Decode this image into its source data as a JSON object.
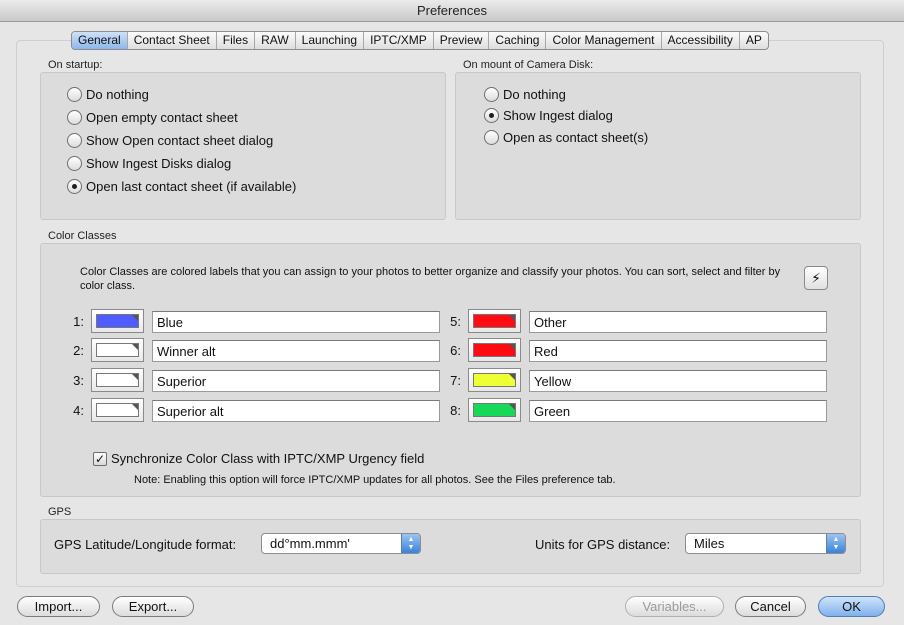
{
  "window": {
    "title": "Preferences"
  },
  "tabs": [
    {
      "label": "General",
      "active": true
    },
    {
      "label": "Contact Sheet"
    },
    {
      "label": "Files"
    },
    {
      "label": "RAW"
    },
    {
      "label": "Launching"
    },
    {
      "label": "IPTC/XMP"
    },
    {
      "label": "Preview"
    },
    {
      "label": "Caching"
    },
    {
      "label": "Color Management"
    },
    {
      "label": "Accessibility"
    },
    {
      "label": "AP"
    }
  ],
  "startup": {
    "label": "On startup:",
    "options": [
      {
        "label": "Do nothing",
        "selected": false
      },
      {
        "label": "Open empty contact sheet",
        "selected": false
      },
      {
        "label": "Show Open contact sheet dialog",
        "selected": false
      },
      {
        "label": "Show Ingest Disks dialog",
        "selected": false
      },
      {
        "label": "Open last contact sheet (if available)",
        "selected": true
      }
    ]
  },
  "camera_disk": {
    "label": "On mount of Camera Disk:",
    "options": [
      {
        "label": "Do nothing",
        "selected": false
      },
      {
        "label": "Show Ingest dialog",
        "selected": true
      },
      {
        "label": "Open as contact sheet(s)",
        "selected": false
      }
    ]
  },
  "color_classes": {
    "label": "Color Classes",
    "description": "Color Classes are colored labels that you can assign to your photos to better organize and classify your photos.  You can sort, select and filter by color class.",
    "lightning_icon": "⚡",
    "items": [
      {
        "num": "1:",
        "name": "Blue",
        "color": "#4f5cff"
      },
      {
        "num": "2:",
        "name": "Winner alt",
        "color": "#ffffff"
      },
      {
        "num": "3:",
        "name": "Superior",
        "color": "#ffffff"
      },
      {
        "num": "4:",
        "name": "Superior alt",
        "color": "#ffffff"
      },
      {
        "num": "5:",
        "name": "Other",
        "color": "#ff0b13"
      },
      {
        "num": "6:",
        "name": "Red",
        "color": "#ff0b13"
      },
      {
        "num": "7:",
        "name": "Yellow",
        "color": "#eeff33"
      },
      {
        "num": "8:",
        "name": "Green",
        "color": "#18d957"
      }
    ],
    "sync_label": "Synchronize Color Class with IPTC/XMP Urgency field",
    "sync_checked": true,
    "note": "Note: Enabling this option will force IPTC/XMP updates for all photos. See the Files preference tab."
  },
  "gps": {
    "label": "GPS",
    "format_label": "GPS Latitude/Longitude format:",
    "format_value": "dd°mm.mmm'",
    "units_label": "Units for GPS distance:",
    "units_value": "Miles"
  },
  "buttons": {
    "import": "Import...",
    "export": "Export...",
    "variables": "Variables...",
    "cancel": "Cancel",
    "ok": "OK"
  }
}
